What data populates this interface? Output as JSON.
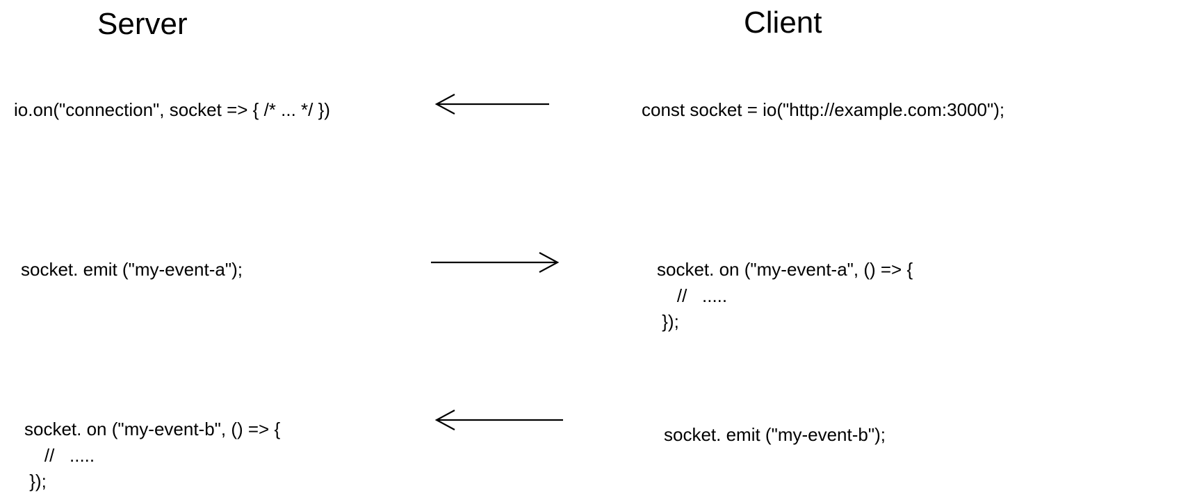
{
  "headings": {
    "server": "Server",
    "client": "Client"
  },
  "server": {
    "row1": "io.on(\"connection\", socket => { /* ... */ })",
    "row2": "socket. emit (\"my-event-a\");",
    "row3": "socket. on (\"my-event-b\", () => {\n    //   .....\n });"
  },
  "client": {
    "row1": "const socket = io(\"http://example.com:3000\");",
    "row2": "socket. on (\"my-event-a\", () => {\n    //   .....\n });",
    "row3": "socket. emit (\"my-event-b\");"
  },
  "arrows": {
    "row1_dir": "left",
    "row2_dir": "right",
    "row3_dir": "left"
  }
}
